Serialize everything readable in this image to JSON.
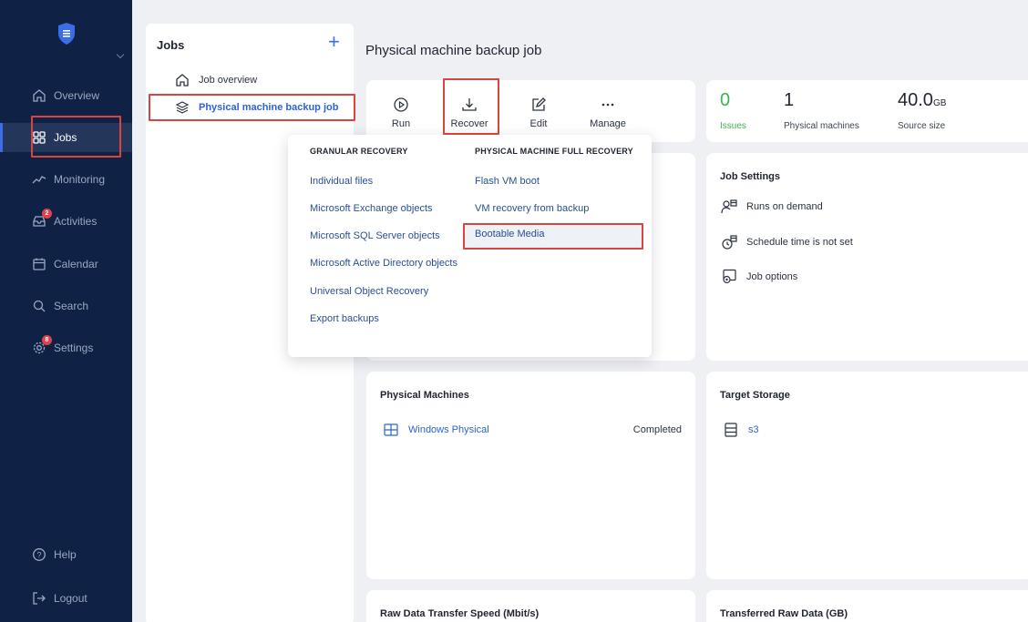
{
  "sidebar": {
    "badges": {
      "activities": "2",
      "settings": "8"
    },
    "items": [
      {
        "label": "Overview",
        "icon": "home-icon"
      },
      {
        "label": "Jobs",
        "icon": "grid-icon"
      },
      {
        "label": "Monitoring",
        "icon": "chart-line-icon"
      },
      {
        "label": "Activities",
        "icon": "inbox-icon"
      },
      {
        "label": "Calendar",
        "icon": "calendar-icon"
      },
      {
        "label": "Search",
        "icon": "search-icon"
      },
      {
        "label": "Settings",
        "icon": "gear-icon"
      }
    ],
    "help": "Help",
    "logout": "Logout"
  },
  "jobs_panel": {
    "title": "Jobs",
    "tree": [
      {
        "label": "Job overview",
        "icon": "home-icon"
      },
      {
        "label": "Physical machine backup job",
        "icon": "layers-icon"
      }
    ]
  },
  "page": {
    "title": "Physical machine backup job"
  },
  "actions": {
    "run": "Run",
    "recover": "Recover",
    "edit": "Edit",
    "manage": "Manage"
  },
  "stats": {
    "issues": {
      "value": "0",
      "label": "Issues"
    },
    "machines": {
      "value": "1",
      "label": "Physical machines"
    },
    "source": {
      "value": "40.0",
      "unit": "GB",
      "label": "Source size"
    }
  },
  "recovery_menu": {
    "granular_heading": "GRANULAR RECOVERY",
    "granular": [
      "Individual files",
      "Microsoft Exchange objects",
      "Microsoft SQL Server objects",
      "Microsoft Active Directory objects",
      "Universal Object Recovery",
      "Export backups"
    ],
    "full_heading": "PHYSICAL MACHINE FULL RECOVERY",
    "full": [
      "Flash VM boot",
      "VM recovery from backup",
      "Bootable Media"
    ]
  },
  "job_settings": {
    "title": "Job Settings",
    "runs": "Runs on demand",
    "schedule": "Schedule time is not set",
    "options": "Job options"
  },
  "physical_machines": {
    "title": "Physical Machines",
    "machine_name": "Windows Physical",
    "status": "Completed"
  },
  "target_storage": {
    "title": "Target Storage",
    "name": "s3"
  },
  "bottom": {
    "speed_title": "Raw Data Transfer Speed (Mbit/s)",
    "transferred_title": "Transferred Raw Data (GB)"
  },
  "colors": {
    "sidebar": "#0f2246",
    "accent": "#2a63d8",
    "success": "#3cb44b",
    "highlight": "#d9443c",
    "badge": "#e2404a"
  }
}
